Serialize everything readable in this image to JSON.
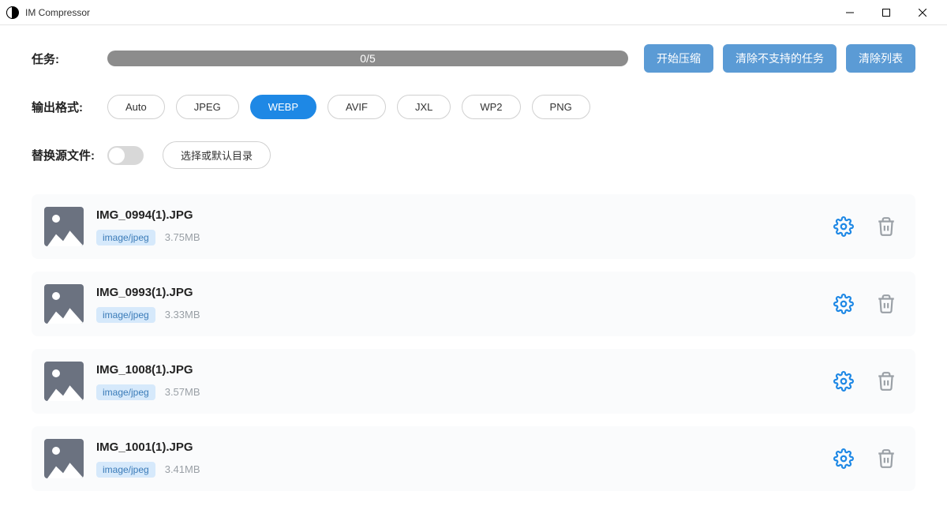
{
  "titlebar": {
    "title": "IM Compressor"
  },
  "labels": {
    "task": "任务:",
    "outputFormat": "输出格式:",
    "replaceSource": "替换源文件:"
  },
  "progress": {
    "text": "0/5"
  },
  "actions": {
    "start": "开始压缩",
    "clearUnsupported": "清除不支持的任务",
    "clearList": "清除列表"
  },
  "formats": [
    "Auto",
    "JPEG",
    "WEBP",
    "AVIF",
    "JXL",
    "WP2",
    "PNG"
  ],
  "activeFormat": "WEBP",
  "dirButton": "选择或默认目录",
  "files": [
    {
      "name": "IMG_0994(1).JPG",
      "mime": "image/jpeg",
      "size": "3.75MB"
    },
    {
      "name": "IMG_0993(1).JPG",
      "mime": "image/jpeg",
      "size": "3.33MB"
    },
    {
      "name": "IMG_1008(1).JPG",
      "mime": "image/jpeg",
      "size": "3.57MB"
    },
    {
      "name": "IMG_1001(1).JPG",
      "mime": "image/jpeg",
      "size": "3.41MB"
    }
  ]
}
